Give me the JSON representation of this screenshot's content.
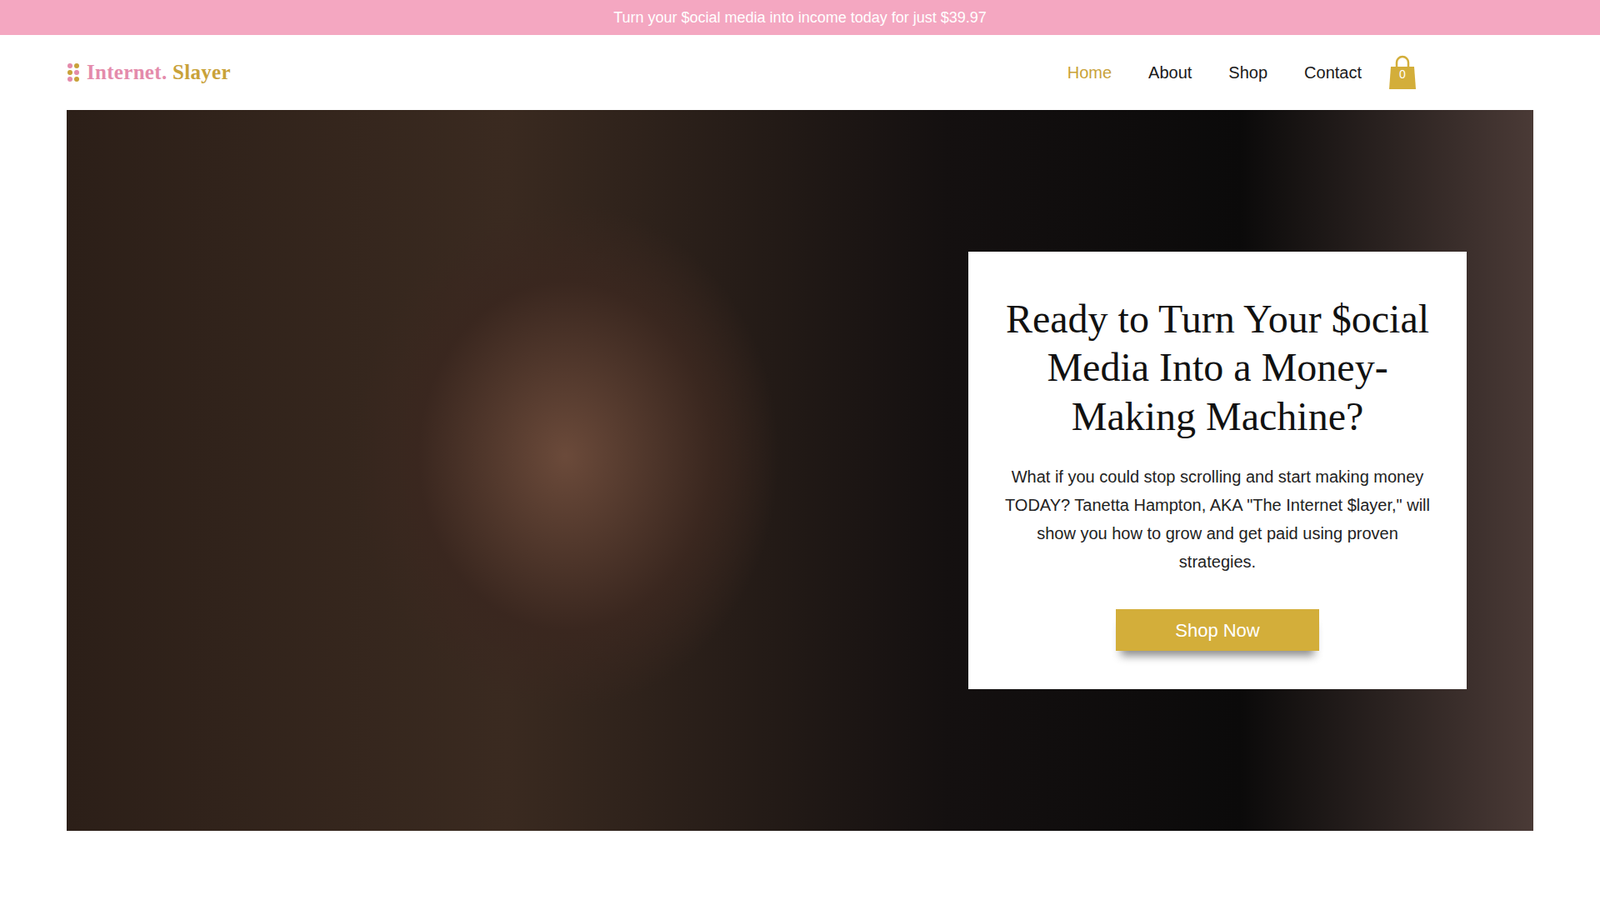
{
  "banner": {
    "text": "Turn your $ocial media into income today for just $39.97"
  },
  "logo": {
    "part1": "Internet.",
    "part2": "Slayer"
  },
  "nav": {
    "items": [
      {
        "label": "Home",
        "selected": true
      },
      {
        "label": "About",
        "selected": false
      },
      {
        "label": "Shop",
        "selected": false
      },
      {
        "label": "Contact",
        "selected": false
      }
    ]
  },
  "cart": {
    "count": "0"
  },
  "hero": {
    "title": "Ready to Turn Your $ocial Media Into a Money-Making Machine?",
    "text": "What if you could stop scrolling and start making money TODAY? Tanetta Hampton, AKA \"The Internet $layer,\" will show you how to grow and get paid using proven strategies.",
    "button": "Shop Now"
  }
}
